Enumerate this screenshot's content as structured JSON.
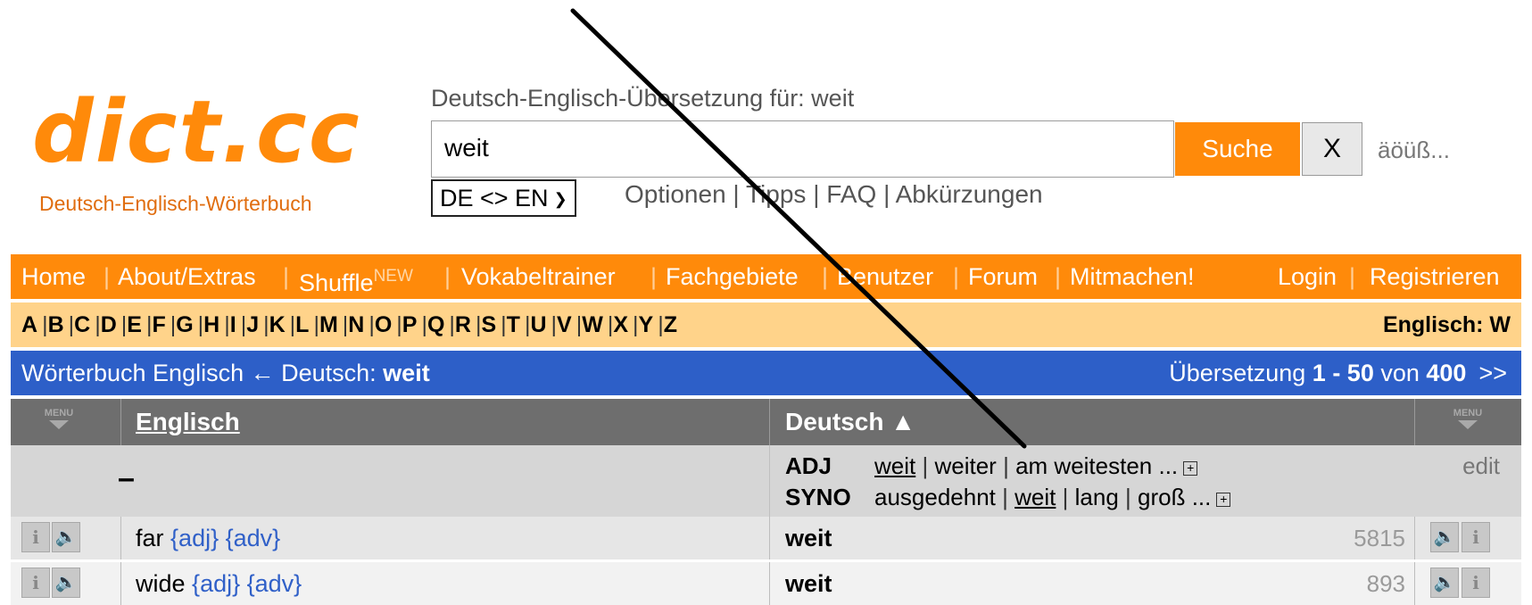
{
  "logo": {
    "text": "dict.cc",
    "subtitle": "Deutsch-Englisch-Wörterbuch"
  },
  "search": {
    "label": "Deutsch-Englisch-Übersetzung für: weit",
    "value": "weit",
    "search_button": "Suche",
    "clear_button": "X",
    "special_chars": "äöüß..."
  },
  "lang_select": {
    "value": "DE <> EN"
  },
  "links": {
    "options": "Optionen",
    "tips": "Tipps",
    "faq": "FAQ",
    "abbr": "Abkürzungen"
  },
  "nav": {
    "home": "Home",
    "about": "About/Extras",
    "shuffle": "Shuffle",
    "new_badge": "NEW",
    "trainer": "Vokabeltrainer",
    "fields": "Fachgebiete",
    "users": "Benutzer",
    "forum": "Forum",
    "contribute": "Mitmachen!",
    "login": "Login",
    "register": "Registrieren"
  },
  "alphabet": {
    "letters": [
      "A",
      "B",
      "C",
      "D",
      "E",
      "F",
      "G",
      "H",
      "I",
      "J",
      "K",
      "L",
      "M",
      "N",
      "O",
      "P",
      "Q",
      "R",
      "S",
      "T",
      "U",
      "V",
      "W",
      "X",
      "Y",
      "Z"
    ],
    "current": "Englisch: W"
  },
  "title_bar": {
    "prefix": "Wörterbuch Englisch ← Deutsch: ",
    "term": "weit",
    "range_prefix": "Übersetzung ",
    "range": "1 - 50",
    "range_mid": " von ",
    "total": "400",
    "next": ">>"
  },
  "table": {
    "menu_label": "MENU",
    "col_en": "Englisch",
    "col_de": "Deutsch ▲",
    "syno": {
      "dash": "–",
      "adj_tag": "ADJ",
      "adj_forms": [
        "weit",
        "weiter",
        "am weitesten ..."
      ],
      "syno_tag": "SYNO",
      "syno_words": [
        "ausgedehnt",
        "weit",
        "lang",
        "groß ..."
      ],
      "edit": "edit"
    },
    "rows": [
      {
        "en": "far",
        "en_tags": "{adj} {adv}",
        "de": "weit",
        "votes": "5815"
      },
      {
        "en": "wide",
        "en_tags": "{adj} {adv}",
        "de": "weit",
        "votes": "893"
      }
    ]
  }
}
